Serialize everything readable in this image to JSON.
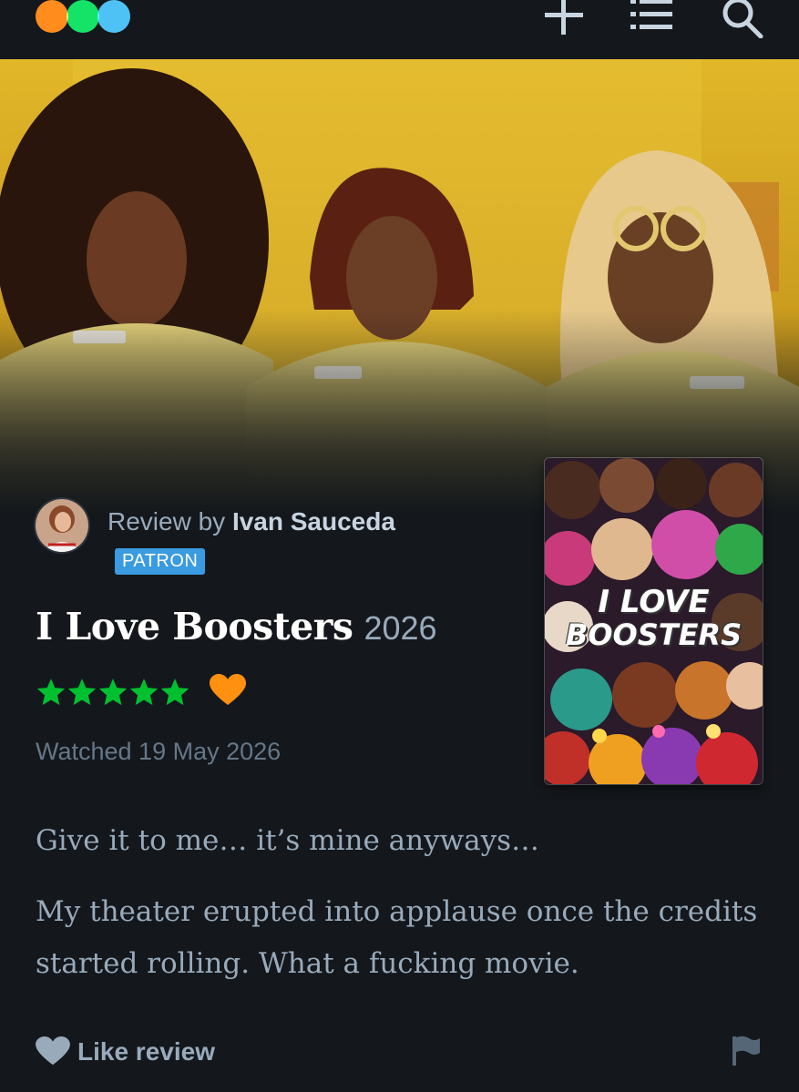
{
  "app": {
    "logo_colors": [
      "#ff8000",
      "#00e054",
      "#40bcf4"
    ]
  },
  "topbar": {
    "icons": [
      "plus-icon",
      "list-icon",
      "search-icon"
    ]
  },
  "review": {
    "prefix": "Review by ",
    "author": "Ivan Sauceda",
    "badge": "PATRON",
    "film_title": "I Love Boosters",
    "film_year": "2026",
    "rating_stars": 5,
    "liked": true,
    "watched": "Watched 19 May 2026",
    "paragraphs": [
      "Give it to me… it’s mine anyways…",
      "My theater erupted into applause once the credits started rolling. What a fucking movie."
    ],
    "like_label": "Like review"
  },
  "poster": {
    "title_line1": "I LOVE",
    "title_line2": "BOOSTERS"
  },
  "colors": {
    "background": "#14181c",
    "star_green": "#00c030",
    "heart_orange": "#ff9010",
    "patron_blue": "#3a9be0",
    "text_muted": "#99aabb"
  }
}
